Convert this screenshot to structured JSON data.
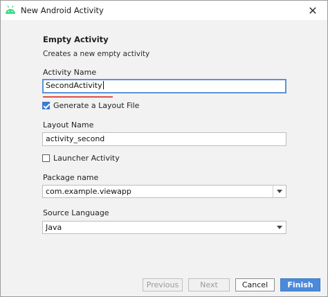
{
  "window": {
    "title": "New Android Activity"
  },
  "section": {
    "title": "Empty Activity",
    "description": "Creates a new empty activity"
  },
  "form": {
    "activity_name": {
      "label": "Activity Name",
      "value": "SecondActivity"
    },
    "generate_layout": {
      "label": "Generate a Layout File",
      "checked": true
    },
    "layout_name": {
      "label": "Layout Name",
      "value": "activity_second"
    },
    "launcher_activity": {
      "label": "Launcher Activity",
      "checked": false
    },
    "package_name": {
      "label": "Package name",
      "value": "com.example.viewapp"
    },
    "source_language": {
      "label": "Source Language",
      "value": "Java"
    }
  },
  "buttons": {
    "previous": "Previous",
    "next": "Next",
    "cancel": "Cancel",
    "finish": "Finish"
  },
  "colors": {
    "accent": "#4a8ad8",
    "focus": "#5a93d6",
    "error_underline": "#e04b4b",
    "android_green": "#3ddc84"
  },
  "icons": {
    "app": "android-icon",
    "close": "close-icon"
  }
}
